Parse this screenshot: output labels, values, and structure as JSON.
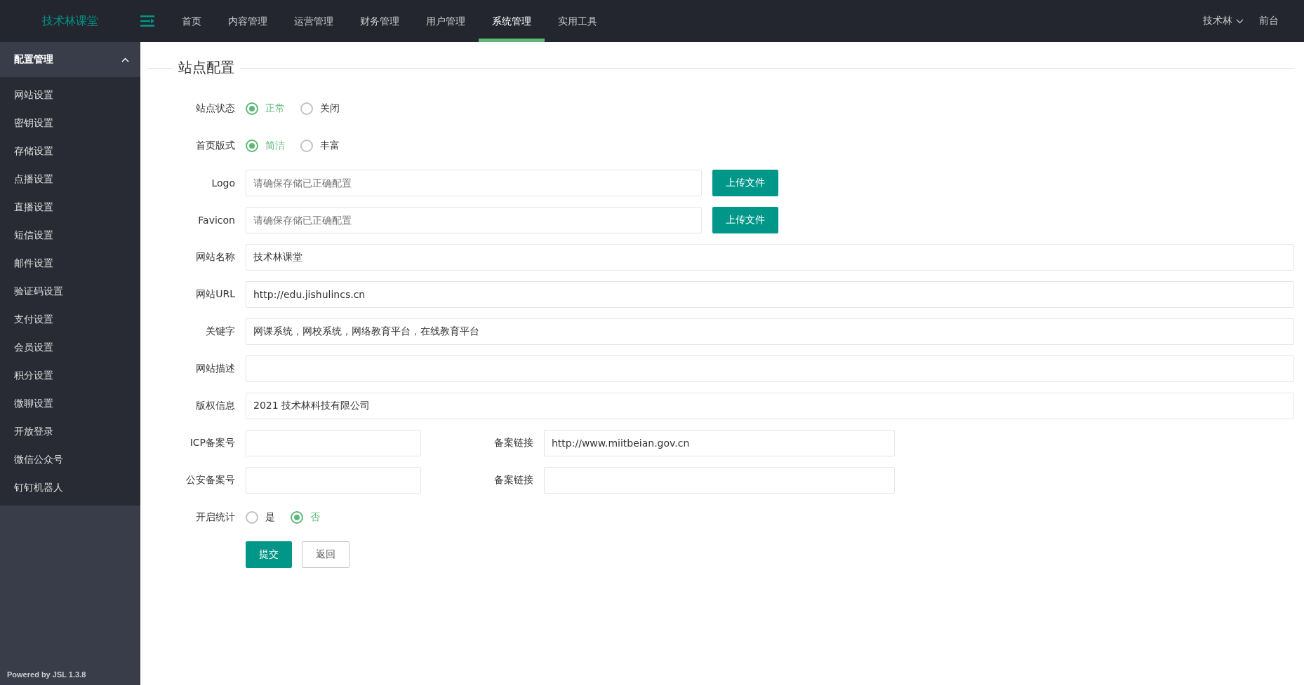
{
  "header": {
    "logo": "技术林课堂",
    "nav": [
      {
        "label": "首页",
        "selected": false
      },
      {
        "label": "内容管理",
        "selected": false
      },
      {
        "label": "运营管理",
        "selected": false
      },
      {
        "label": "财务管理",
        "selected": false
      },
      {
        "label": "用户管理",
        "selected": false
      },
      {
        "label": "系统管理",
        "selected": true
      },
      {
        "label": "实用工具",
        "selected": false
      }
    ],
    "user": "技术林",
    "frontend": "前台"
  },
  "sidebar": {
    "group": {
      "label": "配置管理",
      "expanded": true
    },
    "items": [
      {
        "label": "网站设置",
        "selected": false
      },
      {
        "label": "密钥设置",
        "selected": false
      },
      {
        "label": "存储设置",
        "selected": false
      },
      {
        "label": "点播设置",
        "selected": false
      },
      {
        "label": "直播设置",
        "selected": false
      },
      {
        "label": "短信设置",
        "selected": false
      },
      {
        "label": "邮件设置",
        "selected": false
      },
      {
        "label": "验证码设置",
        "selected": false
      },
      {
        "label": "支付设置",
        "selected": false
      },
      {
        "label": "会员设置",
        "selected": false
      },
      {
        "label": "积分设置",
        "selected": false
      },
      {
        "label": "微聊设置",
        "selected": false
      },
      {
        "label": "开放登录",
        "selected": false
      },
      {
        "label": "微信公众号",
        "selected": false
      },
      {
        "label": "钉钉机器人",
        "selected": false
      }
    ],
    "footer": "Powered by JSL 1.3.8"
  },
  "form": {
    "title": "站点配置",
    "rows": [
      {
        "kind": "radio",
        "label": "站点状态",
        "options": [
          {
            "label": "正常",
            "selected": true
          },
          {
            "label": "关闭",
            "selected": false
          }
        ]
      },
      {
        "kind": "radio",
        "label": "首页版式",
        "options": [
          {
            "label": "简洁",
            "selected": true
          },
          {
            "label": "丰富",
            "selected": false
          }
        ]
      },
      {
        "kind": "upload",
        "label": "Logo",
        "placeholder": "请确保存储已正确配置",
        "button": "上传文件"
      },
      {
        "kind": "upload",
        "label": "Favicon",
        "placeholder": "请确保存储已正确配置",
        "button": "上传文件"
      },
      {
        "kind": "text",
        "label": "网站名称",
        "value": "技术林课堂"
      },
      {
        "kind": "text",
        "label": "网站URL",
        "value": "http://edu.jishulincs.cn"
      },
      {
        "kind": "text",
        "label": "关键字",
        "value": "网课系统，网校系统，网络教育平台，在线教育平台"
      },
      {
        "kind": "text",
        "label": "网站描述"
      },
      {
        "kind": "text",
        "label": "版权信息",
        "value": "2021 技术林科技有限公司"
      },
      {
        "kind": "pair",
        "label": "ICP备案号",
        "label2": "备案链接",
        "value2": "http://www.miitbeian.gov.cn"
      },
      {
        "kind": "pair",
        "label": "公安备案号",
        "label2": "备案链接"
      },
      {
        "kind": "radio",
        "label": "开启统计",
        "options": [
          {
            "label": "是",
            "selected": false
          },
          {
            "label": "否",
            "selected": true
          }
        ]
      }
    ],
    "submit": "提交",
    "back": "返回"
  }
}
